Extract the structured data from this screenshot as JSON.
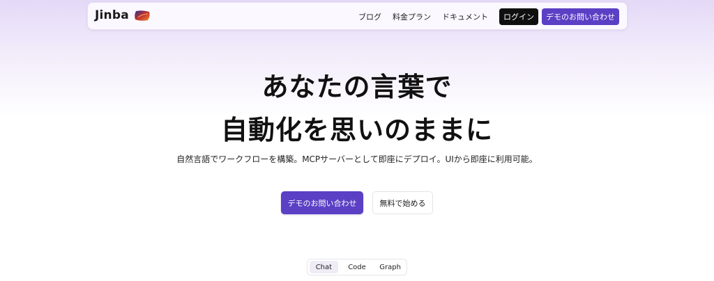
{
  "brand": {
    "name": "Jinba",
    "colors": {
      "accent": "#5b3fc4",
      "dark_button": "#0f0f10",
      "header_tint": "#e4d9f7"
    }
  },
  "nav": {
    "links": [
      "ブログ",
      "料金プラン",
      "ドキュメント"
    ],
    "login_label": "ログイン",
    "demo_label": "デモのお問い合わせ"
  },
  "hero": {
    "title_line1": "あなたの言葉で",
    "title_line2": "自動化を思いのままに",
    "subtitle": "自然言語でワークフローを構築。MCPサーバーとして即座にデプロイ。UIから即座に利用可能。",
    "cta_primary": "デモのお問い合わせ",
    "cta_secondary": "無料で始める"
  },
  "tabs": {
    "items": [
      "Chat",
      "Code",
      "Graph"
    ],
    "active": "Chat"
  }
}
